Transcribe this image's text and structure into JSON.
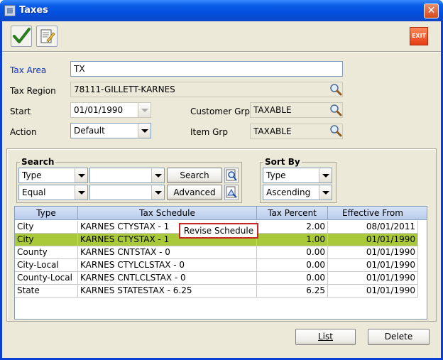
{
  "window": {
    "title": "Taxes",
    "close_glyph": "✕"
  },
  "toolbar": {
    "save_icon": "checkmark-icon",
    "edit_icon": "notepad-icon",
    "exit_label": "EXIT"
  },
  "form": {
    "tax_area": {
      "label": "Tax Area",
      "value": "TX"
    },
    "tax_region": {
      "label": "Tax Region",
      "value": "78111-GILLETT-KARNES"
    },
    "start": {
      "label": "Start",
      "value": "01/01/1990"
    },
    "action": {
      "label": "Action",
      "value": "Default"
    },
    "customer_grp": {
      "label": "Customer Grp",
      "value": "TAXABLE"
    },
    "item_grp": {
      "label": "Item Grp",
      "value": "TAXABLE"
    }
  },
  "search": {
    "title": "Search",
    "field1": "Type",
    "field2": "",
    "operator": "Equal",
    "value2": "",
    "search_label": "Search",
    "advanced_label": "Advanced"
  },
  "sort": {
    "title": "Sort By",
    "field": "Type",
    "order": "Ascending"
  },
  "table": {
    "columns": [
      "Type",
      "Tax Schedule",
      "Tax Percent",
      "Effective From"
    ],
    "rows": [
      [
        "City",
        "KARNES CTYSTAX - 1",
        "2.00",
        "08/01/2011"
      ],
      [
        "City",
        "KARNES CTYSTAX - 1",
        "1.00",
        "01/01/1990"
      ],
      [
        "County",
        "KARNES CNTSTAX - 0",
        "0.00",
        "01/01/1990"
      ],
      [
        "City-Local",
        "KARNES CTYLCLSTAX - 0",
        "0.00",
        "01/01/1990"
      ],
      [
        "County-Local",
        "KARNES CNTLCLSTAX - 0",
        "0.00",
        "01/01/1990"
      ],
      [
        "State",
        "KARNES STATESTAX - 6.25",
        "6.25",
        "01/01/1990"
      ]
    ],
    "selected_row": 1
  },
  "tooltip": "Revise Schedule",
  "buttons": {
    "list": "List",
    "delete": "Delete"
  },
  "colors": {
    "selected_row": "#a9c93b",
    "tooltip_border": "#c42727",
    "label_blue": "#1030c0"
  }
}
